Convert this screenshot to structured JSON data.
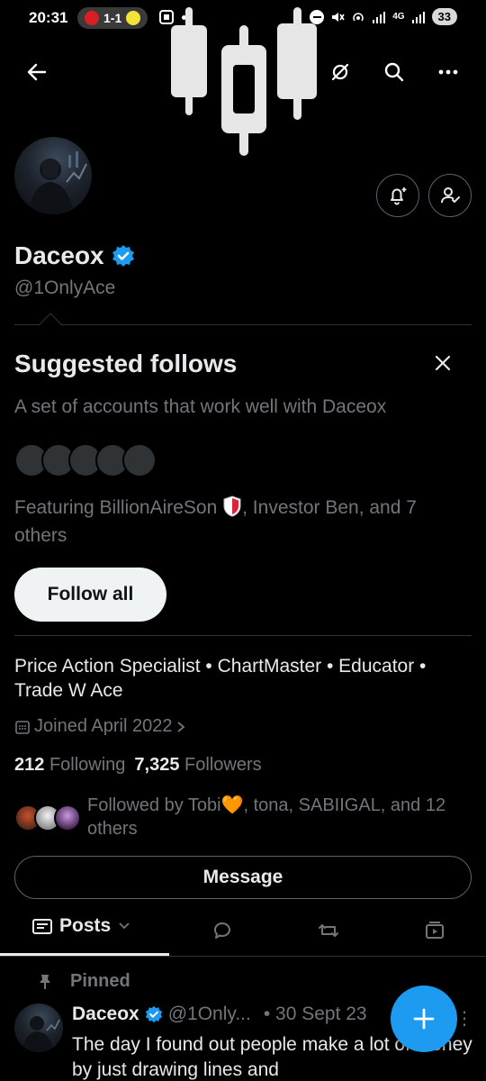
{
  "status_bar": {
    "time": "20:31",
    "score": "1-1",
    "network": "4G",
    "battery": "33"
  },
  "profile": {
    "display_name": "Daceox",
    "handle": "@1OnlyAce",
    "verified": true,
    "bio": "Price Action Specialist  • ChartMaster • Educator • Trade W Ace",
    "joined": "Joined April 2022",
    "following_count": "212",
    "following_label": "Following",
    "followers_count": "7,325",
    "followers_label": "Followers",
    "followed_by": "Followed by Tobi🧡, tona, SABIIGAL, and 12 others"
  },
  "suggested": {
    "title": "Suggested follows",
    "description": "A set of accounts that work well with Daceox",
    "featuring_prefix": "Featuring BillionAireSon",
    "featuring_suffix": ", Investor Ben, and 7 others",
    "follow_all_label": "Follow all"
  },
  "actions": {
    "message_label": "Message"
  },
  "tabs": {
    "posts_label": "Posts"
  },
  "pinned_post": {
    "pinned_label": "Pinned",
    "author": "Daceox",
    "handle": "@1Only...",
    "date": "• 30 Sept 23",
    "text": "The day I found out people make a lot of money by just drawing lines and"
  },
  "colors": {
    "accent": "#1d9bf0",
    "background": "#000000",
    "text_primary": "#e7e9ea",
    "text_secondary": "#71767b"
  },
  "icons": {
    "back": "arrow-left-icon",
    "candles": "candlestick-icon",
    "hide": "slashed-circle-icon",
    "search": "search-icon",
    "more": "more-horizontal-icon",
    "notify": "bell-plus-icon",
    "following": "user-check-icon",
    "close": "close-icon",
    "calendar": "calendar-icon",
    "fab": "plus-icon"
  }
}
